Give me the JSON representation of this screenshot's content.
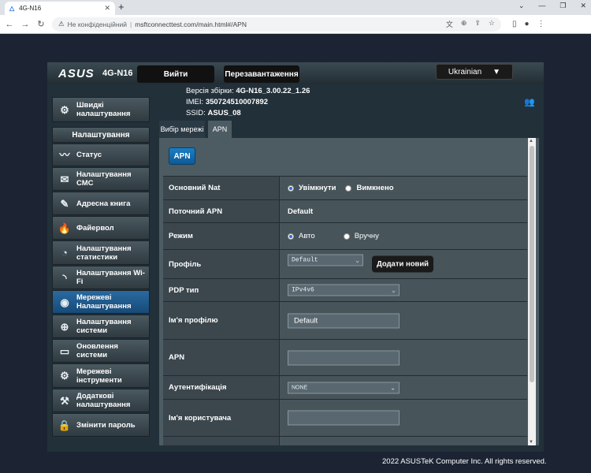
{
  "browser": {
    "tab_title": "4G-N16",
    "tab_close": "✕",
    "new_tab": "+",
    "insecure_label": "Не конфіденційний",
    "url": "msftconnecttest.com/main.html#/APN"
  },
  "header": {
    "logo": "ASUS",
    "model": "4G-N16",
    "btn_login": "Вийти",
    "btn_reboot": "Перезавантаження",
    "language": "Ukrainian"
  },
  "info": {
    "firmware_label": "Версія збірки:",
    "firmware_value": "4G-N16_3.00.22_1.26",
    "imei_label": "IMEI:",
    "imei_value": "350724510007892",
    "ssid_label": "SSID:",
    "ssid_value": "ASUS_08"
  },
  "sidebar": {
    "quick_setup": "Швидкі налаштування",
    "settings_header": "Налаштування",
    "items": [
      {
        "label": "Статус"
      },
      {
        "label": "Налаштування СМС"
      },
      {
        "label": "Адресна книга"
      },
      {
        "label": "Файервол"
      },
      {
        "label": "Налаштування статистики"
      },
      {
        "label": "Налаштування Wi-Fi"
      },
      {
        "label": "Мережеві Налаштування"
      },
      {
        "label": "Налаштування системи"
      },
      {
        "label": "Оновлення системи"
      },
      {
        "label": "Мережеві інструменти"
      },
      {
        "label": "Додаткові налаштування"
      },
      {
        "label": "Змінити пароль"
      }
    ]
  },
  "tabs": {
    "network_select": "Вибір мережі",
    "apn": "APN"
  },
  "content": {
    "apn_badge": "APN",
    "rows": {
      "main_nat_label": "Основний Nat",
      "nat_on": "Увімкнути",
      "nat_off": "Вимкнено",
      "current_apn_label": "Поточний APN",
      "current_apn_value": "Default",
      "mode_label": "Режим",
      "mode_auto": "Авто",
      "mode_manual": "Вручну",
      "profile_label": "Профіль",
      "profile_value": "Default",
      "add_new": "Додати новий",
      "pdp_label": "PDP тип",
      "pdp_value": "IPv4v6",
      "profile_name_label": "Ім'я профілю",
      "profile_name_value": "Default",
      "apn_label": "APN",
      "apn_value": "",
      "auth_label": "Аутентифікація",
      "auth_value": "NONE",
      "username_label": "Ім'я користувача",
      "username_value": ""
    }
  },
  "footer": "2022 ASUSTeK Computer Inc. All rights reserved."
}
